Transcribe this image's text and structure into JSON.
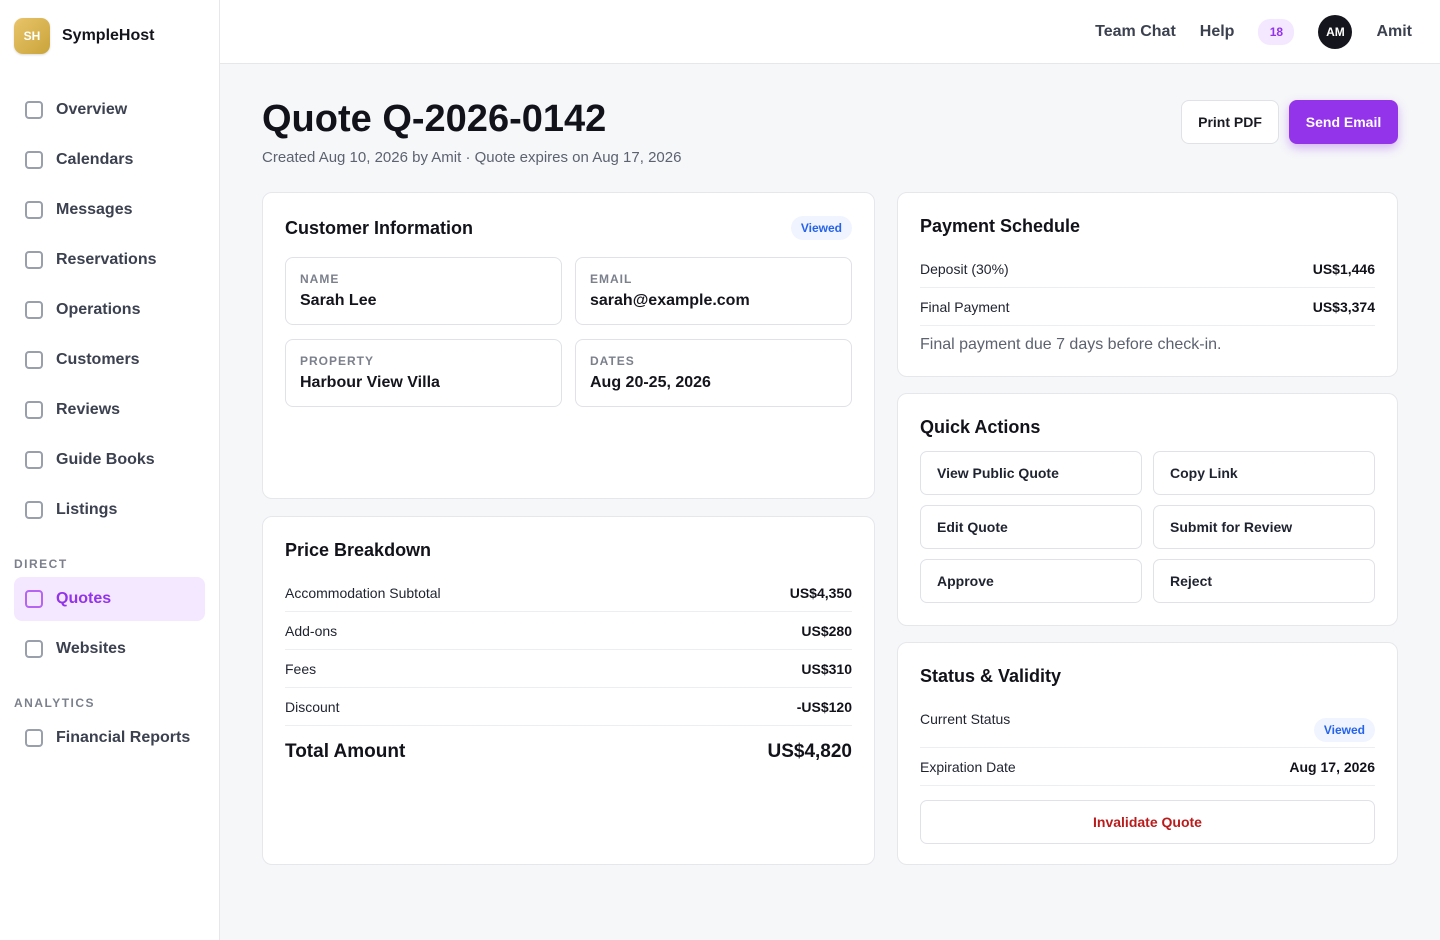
{
  "brand": {
    "logo_text": "SH",
    "name": "SympleHost",
    "logo_color": "#d8b455"
  },
  "nav": {
    "main": [
      {
        "label": "Overview"
      },
      {
        "label": "Calendars"
      },
      {
        "label": "Messages"
      },
      {
        "label": "Reservations"
      },
      {
        "label": "Operations"
      },
      {
        "label": "Customers"
      },
      {
        "label": "Reviews"
      },
      {
        "label": "Guide Books"
      },
      {
        "label": "Listings"
      }
    ],
    "direct_label": "DIRECT",
    "direct": [
      {
        "label": "Quotes",
        "active": true
      },
      {
        "label": "Websites"
      }
    ],
    "analytics_label": "ANALYTICS",
    "analytics": [
      {
        "label": "Financial Reports"
      }
    ]
  },
  "topbar": {
    "team_chat": "Team Chat",
    "help": "Help",
    "notification_count": "18",
    "avatar_initials": "AM",
    "user_name": "Amit"
  },
  "header": {
    "title": "Quote Q-2026-0142",
    "subtitle": "Created Aug 10, 2026 by Amit · Quote expires on Aug 17, 2026",
    "print_label": "Print PDF",
    "send_label": "Send Email"
  },
  "customer": {
    "title": "Customer Information",
    "status": "Viewed",
    "name_label": "NAME",
    "name": "Sarah Lee",
    "email_label": "EMAIL",
    "email": "sarah@example.com",
    "property_label": "PROPERTY",
    "property": "Harbour View Villa",
    "dates_label": "DATES",
    "dates": "Aug 20-25, 2026"
  },
  "price": {
    "title": "Price Breakdown",
    "rows": [
      {
        "label": "Accommodation Subtotal",
        "value": "US$4,350"
      },
      {
        "label": "Add-ons",
        "value": "US$280"
      },
      {
        "label": "Fees",
        "value": "US$310"
      },
      {
        "label": "Discount",
        "value": "-US$120"
      }
    ],
    "total_label": "Total Amount",
    "total_value": "US$4,820"
  },
  "payment": {
    "title": "Payment Schedule",
    "rows": [
      {
        "label": "Deposit (30%)",
        "value": "US$1,446"
      },
      {
        "label": "Final Payment",
        "value": "US$3,374"
      }
    ],
    "note": "Final payment due 7 days before check-in."
  },
  "actions": {
    "title": "Quick Actions",
    "buttons": [
      "View Public Quote",
      "Copy Link",
      "Edit Quote",
      "Submit for Review",
      "Approve",
      "Reject"
    ]
  },
  "status": {
    "title": "Status & Validity",
    "current_label": "Current Status",
    "current_value": "Viewed",
    "expiration_label": "Expiration Date",
    "expiration_value": "Aug 17, 2026",
    "invalidate_label": "Invalidate Quote"
  },
  "colors": {
    "accent": "#9333ea",
    "status_blue": "#2563eb",
    "danger": "#b91c1c"
  }
}
